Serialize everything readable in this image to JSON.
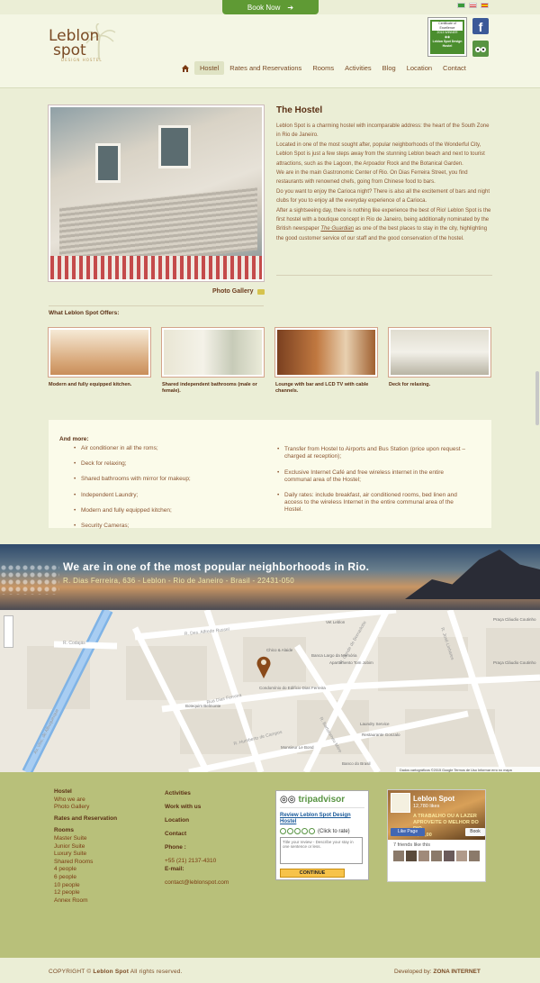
{
  "book": {
    "label": "Book Now"
  },
  "logo": {
    "line1": "Leblon",
    "line2": "spot",
    "tagline": "DESIGN HOSTEL"
  },
  "badge": {
    "title": "Certificate of Excellence",
    "year": "2013 WINNER",
    "label": "Leblon Spot Design Hostel"
  },
  "nav": {
    "items": [
      "Hostel",
      "Rates and Reservations",
      "Rooms",
      "Activities",
      "Blog",
      "Location",
      "Contact"
    ],
    "active": "Hostel"
  },
  "main": {
    "title": "The Hostel",
    "paragraphs": [
      "Leblon Spot is a charming hostel with incomparable address: the heart of the South Zone in Rio de Janeiro.",
      "Located in one of the most sought after, popular neighborhoods of the Wonderful City, Leblon Spot is just a few steps away from the stunning Leblon beach and next to tourist attractions, such as the Lagoon, the Arpoador Rock and the Botanical Garden.",
      "We are in the main Gastronomic Center of Rio. On Dias Ferreira Street, you find restaurants with renowned chefs, going from Chinese food to bars.",
      "Do you want to enjoy the Carioca night? There is also all the excitement of bars and night clubs for you to enjoy all the everyday experience of a Carioca.",
      "After a sightseeing day, there is nothing like experience the best of Rio! Leblon Spot is the first hostel with a boutique concept in Rio de Janeiro, being additionally nominated by the British newspaper"
    ],
    "guardian": "The Guardian",
    "tail": "as one of the best places to stay in the city, highlighting the good customer service of our staff and the good conservation of the hostel.",
    "photo_gallery": "Photo Gallery"
  },
  "offers": {
    "title": "What Leblon Spot Offers:",
    "items": [
      {
        "caption": "Modern and fully equipped kitchen.",
        "color": "#e8c8a0"
      },
      {
        "caption": "Shared independent bathrooms (male or female).",
        "color": "#d9d4c0"
      },
      {
        "caption": "Lounge with bar and LCD TV with cable channels.",
        "color": "#b07040"
      },
      {
        "caption": "Deck for relaxing.",
        "color": "#cfcab8"
      }
    ]
  },
  "more": {
    "title": "And more:",
    "left": [
      "Air conditioner in all the roms;",
      "Deck for relaxing;",
      "Shared bathrooms with mirror for makeup;",
      "Independent Laundry;",
      "Modern  and fully equipped kitchen;",
      "Security Cameras;"
    ],
    "right": [
      "Transfer from Hostel to Airports and Bus Station (price upon request – charged at reception);",
      "Exclusive Internet Café and free wireless internet in the entire communal area of the Hostel;",
      "Daily rates: include breakfast, air conditioned rooms, bed linen and access to the wireless Internet in the entire communal area of the Hostel."
    ]
  },
  "banner": {
    "title": "We are in one of the most popular neighborhoods in Rio.",
    "address": "R. Dias Ferreira, 636 - Leblon - Rio de Janeiro - Brasil - 22431-050"
  },
  "map": {
    "streets": [
      "R. Des. Alfredo Russel",
      "Av. Visc. de Albuquerque",
      "Rua Dias Ferreira",
      "R. Humberto de Campos",
      "R. Bartolomeu Mitre",
      "R. Conde de Bernadotte",
      "R. José Linhares",
      "R. Cupertino Durão",
      "R. Codajás",
      "R. Gen. Urquiza"
    ],
    "places": [
      "Vet Leblon",
      "Banca Largo da Memória",
      "Chico & Alaide",
      "Apartamento Tom Jobim",
      "Condomínio do Edifício Dias Ferreira",
      "Restaurante Gonzalo",
      "Laundry Service",
      "Monsieur Le Bond",
      "Banco do Brasil",
      "Botequim Belmonte",
      "Praça Cláudio Coutinho",
      "Praça Cláudio Coutinho"
    ],
    "footer": "Dados cartográficos ©2015 Google   Termos de Uso   Informar erro no mapa"
  },
  "footer": {
    "col1": {
      "hostel": "Hostel",
      "hostel_items": [
        "Who we are",
        "Photo Gallery"
      ],
      "rates": "Rates and Reservation",
      "rooms": "Rooms",
      "room_items": [
        "Master Suite",
        "Junior Suite",
        "Luxury Suite",
        "Shared Rooms",
        "4 people",
        "6 people",
        "10 people",
        "12 people",
        "Annex Room"
      ]
    },
    "col2": {
      "activities": "Activities",
      "work": "Work with us",
      "location": "Location",
      "contact": "Contact",
      "phone_label": "Phone :",
      "phone": "+55 (21) 2137-4310",
      "email_label": "E-mail:",
      "email": "contact@leblonspot.com"
    },
    "tripadvisor": {
      "logo": "tripadvisor",
      "review": "Review Leblon Spot Design Hostel",
      "rate": "(Click to rate)",
      "placeholder": "Title your review - Describe your stay in one sentence or less.",
      "button": "CONTINUE"
    },
    "facebook": {
      "name": "Leblon Spot",
      "likes": "12,780 likes",
      "tagline": "A TRABALHO OU A LAZER",
      "tagline2": "APROVEITE O MELHOR DO RIO.",
      "price": "R$60,00",
      "like": "Like Page",
      "book": "Book",
      "friends": "7 friends like this"
    }
  },
  "copyright": {
    "prefix": "COPYRIGHT ©",
    "brand": "Leblon Spot",
    "suffix": "All rights reserved."
  },
  "developer": {
    "label": "Developed by:",
    "name": "ZONA INTERNET"
  }
}
